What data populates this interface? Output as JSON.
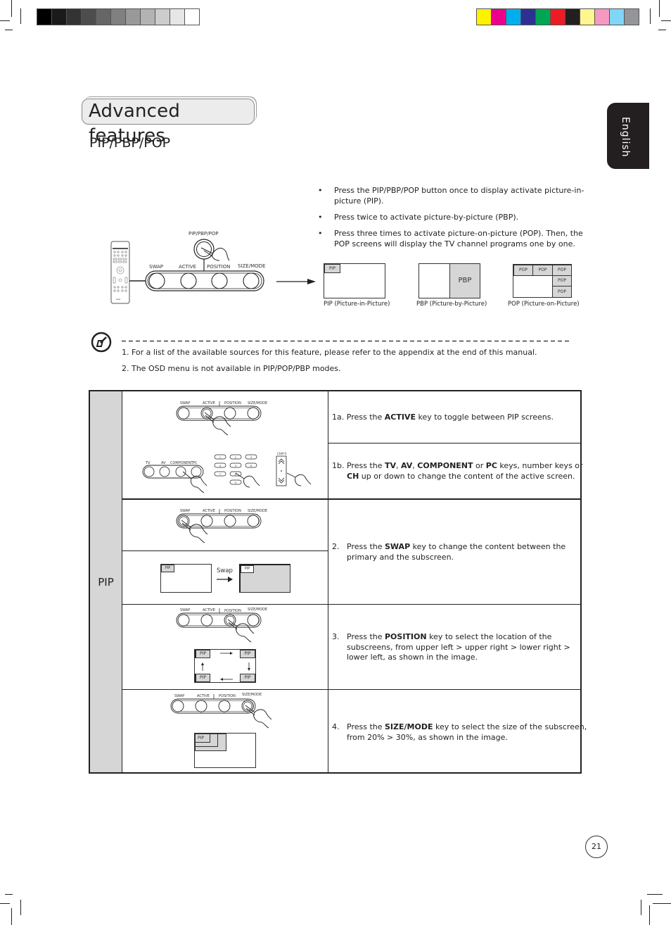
{
  "colorbars": {
    "gray": [
      "#000000",
      "#1a1a1a",
      "#333333",
      "#4d4d4d",
      "#666666",
      "#808080",
      "#999999",
      "#b3b3b3",
      "#cccccc",
      "#e6e6e6",
      "#ffffff"
    ],
    "color": [
      "#fff200",
      "#ec008c",
      "#00aeef",
      "#2e3192",
      "#00a651",
      "#ed1c24",
      "#231f20",
      "#fff68f",
      "#f49ac1",
      "#7fd6f7",
      "#939598"
    ]
  },
  "header": {
    "title": "Advanced features",
    "subtitle": "PIP/PBP/POP",
    "language_tab": "English"
  },
  "overview": {
    "button_label": "PIP/PBP/POP",
    "keys": [
      "SWAP",
      "ACTIVE",
      "POSITION",
      "SIZE/MODE"
    ],
    "bullets": [
      "Press the PIP/PBP/POP button once to display activate picture-in-picture (PIP).",
      "Press twice to activate picture-by-picture (PBP).",
      "Press three times to activate picture-on-picture (POP). Then, the POP screens will display the TV channel programs one by one."
    ],
    "modes": [
      {
        "label": "PIP",
        "caption": "PIP (Picture-in-Picture)"
      },
      {
        "label": "PBP",
        "caption": "PBP (Picture-by-Picture)"
      },
      {
        "label": "POP",
        "caption": "POP (Picture-on-Picture)"
      }
    ]
  },
  "notes": {
    "icon": "note-icon",
    "items": [
      "1.  For a list of the available sources for this feature, please refer to the appendix at the end of this manual.",
      "2.  The OSD menu is not available in PIP/POP/PBP modes."
    ]
  },
  "table": {
    "section_label": "PIP",
    "source_keys": [
      "TV",
      "AV",
      "COMPONENT",
      "PC"
    ],
    "number_keys": [
      "1",
      "2",
      "3",
      "4",
      "5",
      "6",
      "7",
      "8",
      "9",
      "0"
    ],
    "ch_label": "CH/P-S",
    "swap_label": "Swap",
    "pip_tag": "PIP",
    "steps": {
      "s1a": {
        "num": "1a.",
        "pre": "Press the ",
        "k1": "ACTIVE",
        "post": " key to toggle between PIP screens."
      },
      "s1b": {
        "num": "1b.",
        "pre": "Press the ",
        "k1": "TV",
        "c1": ", ",
        "k2": "AV",
        "c2": ", ",
        "k3": "COMPONENT",
        "c3": " or ",
        "k4": "PC",
        "c4": " keys, number keys or ",
        "k5": "CH",
        "post": " up or down to change the content of the active screen."
      },
      "s2": {
        "num": "2.",
        "pre": "Press the ",
        "k1": "SWAP",
        "post": " key to change the content between the primary and the subscreen."
      },
      "s3": {
        "num": "3.",
        "pre": "Press the ",
        "k1": "POSITION",
        "post": " key to select the location of the subscreens, from upper left > upper right > lower right > lower left, as shown in the image."
      },
      "s4": {
        "num": "4.",
        "pre": "Press the ",
        "k1": "SIZE/MODE",
        "post": " key to select the size of the subscreen, from 20% > 30%, as shown in the image."
      }
    }
  },
  "footer": {
    "page_number": "21"
  }
}
